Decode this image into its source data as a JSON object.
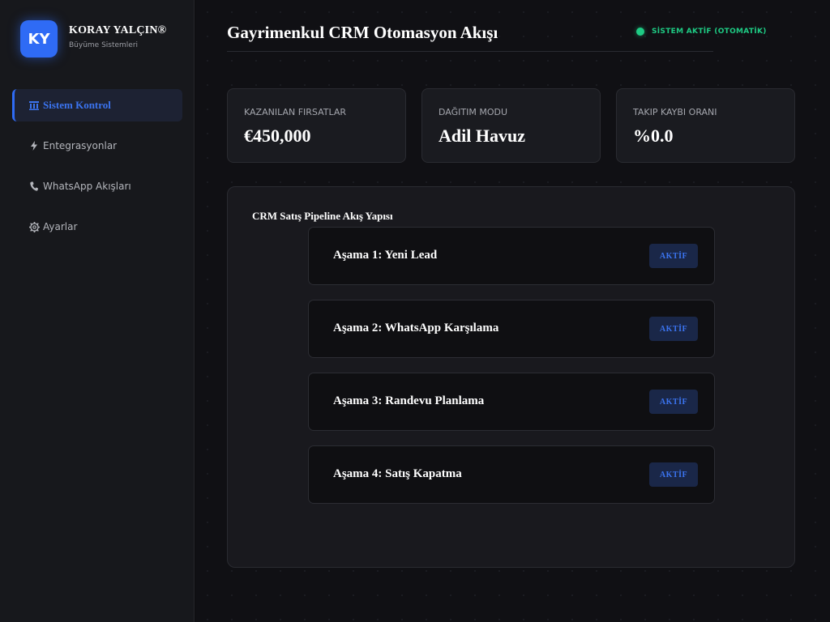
{
  "brand": {
    "logo_text": "KY",
    "name": "KORAY YALÇIN®",
    "subtitle": "Büyüme Sistemleri"
  },
  "sidebar": {
    "items": [
      {
        "icon": "building-columns-icon",
        "glyph": "🏛",
        "label": "Sistem Kontrol",
        "active": true
      },
      {
        "icon": "lightning-icon",
        "glyph": "⚡",
        "label": "Entegrasyonlar",
        "active": false
      },
      {
        "icon": "phone-icon",
        "glyph": "📞",
        "label": "WhatsApp Akışları",
        "active": false
      },
      {
        "icon": "gear-icon",
        "glyph": "⚙",
        "label": "Ayarlar",
        "active": false
      }
    ]
  },
  "header": {
    "title": "Gayrimenkul CRM Otomasyon Akışı",
    "status_text": "SİSTEM AKTİF (OTOMATİK)",
    "status_color": "#1ecb84"
  },
  "stats": [
    {
      "label": "KAZANILAN FIRSATLAR",
      "value": "€450,000"
    },
    {
      "label": "DAĞITIM MODU",
      "value": "Adil Havuz"
    },
    {
      "label": "TAKIP KAYBI ORANI",
      "value": "%0.0"
    }
  ],
  "pipeline": {
    "title": "CRM Satış Pipeline Akış Yapısı",
    "stages": [
      {
        "label": "Aşama 1: Yeni Lead",
        "badge": "AKTİF"
      },
      {
        "label": "Aşama 2: WhatsApp Karşılama",
        "badge": "AKTİF"
      },
      {
        "label": "Aşama 3: Randevu Planlama",
        "badge": "AKTİF"
      },
      {
        "label": "Aşama 4: Satış Kapatma",
        "badge": "AKTİF"
      }
    ]
  },
  "colors": {
    "accent": "#2f6bf5",
    "success": "#1ecb84"
  }
}
